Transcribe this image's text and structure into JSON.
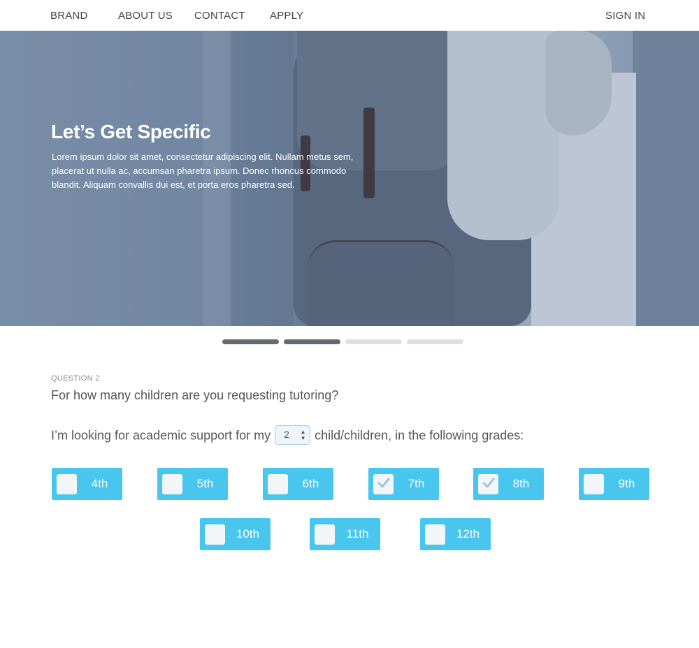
{
  "nav": {
    "brand": "BRAND",
    "about": "ABOUT US",
    "contact": "CONTACT",
    "apply": "APPLY",
    "signin": "SIGN IN"
  },
  "hero": {
    "title": "Let’s Get Specific",
    "body": "Lorem ipsum dolor sit amet, consectetur adipiscing elit. Nullam metus sem, placerat ut nulla ac, accumsan pharetra ipsum. Donec rhoncus commodo blandit. Aliquam convallis dui est, et porta eros pharetra sed."
  },
  "pager": {
    "total": 4,
    "active": [
      true,
      true,
      false,
      false
    ]
  },
  "question": {
    "number": "QUESTION 2",
    "text": "For how many children are you requesting tutoring?",
    "sentence_before": "I’m looking for academic support for my",
    "children_count": "2",
    "sentence_after": "child/children, in the following grades:"
  },
  "grades": [
    {
      "label": "4th",
      "checked": false
    },
    {
      "label": "5th",
      "checked": false
    },
    {
      "label": "6th",
      "checked": false
    },
    {
      "label": "7th",
      "checked": true
    },
    {
      "label": "8th",
      "checked": true
    },
    {
      "label": "9th",
      "checked": false
    },
    {
      "label": "10th",
      "checked": false
    },
    {
      "label": "11th",
      "checked": false
    },
    {
      "label": "12th",
      "checked": false
    }
  ],
  "colors": {
    "accent": "#48c6ee",
    "checkbox_bg": "#f2f6f9",
    "check_mark": "#a5c3d4",
    "pager_active": "#666a6e",
    "pager_inactive": "#e0e0e0"
  },
  "icons": {
    "stepper": "up-down-arrows-icon",
    "checked": "checkmark-icon"
  }
}
